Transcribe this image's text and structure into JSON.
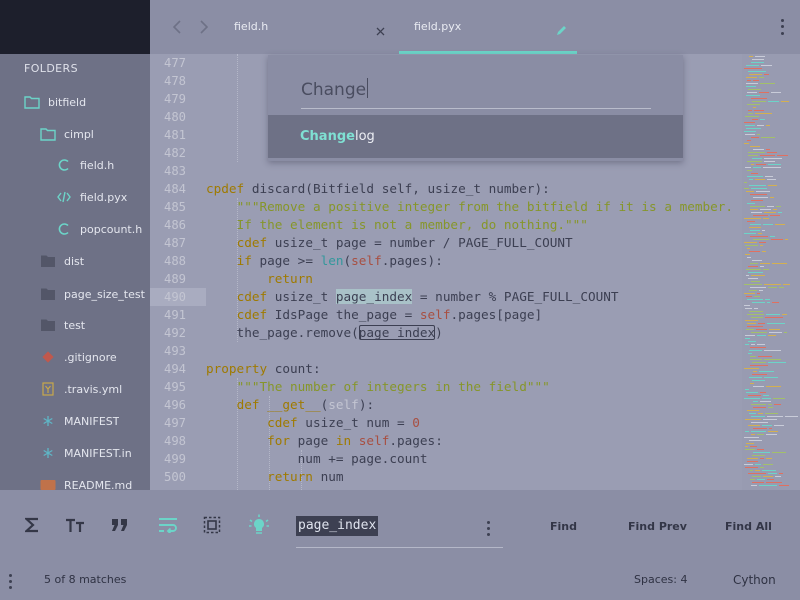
{
  "sidebar": {
    "title": "FOLDERS",
    "items": [
      {
        "label": "bitfield",
        "icon": "folder-open-icon"
      },
      {
        "label": "cimpl",
        "icon": "folder-open-icon"
      },
      {
        "label": "field.h",
        "icon": "c-file-icon"
      },
      {
        "label": "field.pyx",
        "icon": "code-file-icon"
      },
      {
        "label": "popcount.h",
        "icon": "c-file-icon"
      },
      {
        "label": "dist",
        "icon": "folder-icon"
      },
      {
        "label": "page_size_test",
        "icon": "folder-icon"
      },
      {
        "label": "test",
        "icon": "folder-icon"
      },
      {
        "label": ".gitignore",
        "icon": "git-icon"
      },
      {
        "label": ".travis.yml",
        "icon": "yaml-file-icon"
      },
      {
        "label": "MANIFEST",
        "icon": "asterisk-icon"
      },
      {
        "label": "MANIFEST.in",
        "icon": "asterisk-icon"
      },
      {
        "label": "README.md",
        "icon": "markdown-file-icon"
      }
    ]
  },
  "tabs": [
    {
      "label": "field.h",
      "icon": "close-icon"
    },
    {
      "label": "field.pyx",
      "icon": "edit-pencil-icon",
      "active": true
    }
  ],
  "palette": {
    "query": "Change",
    "result_match": "Change",
    "result_rest": "log"
  },
  "editor": {
    "line_numbers": [
      "477",
      "478",
      "479",
      "480",
      "481",
      "482",
      "483",
      "484",
      "485",
      "486",
      "487",
      "488",
      "489",
      "490",
      "491",
      "492",
      "493",
      "494",
      "495",
      "496",
      "497",
      "498",
      "499",
      "500"
    ],
    "active_line": "490",
    "minimap_colors": [
      "#6cd4c8",
      "#d4b050",
      "#c9ccd9",
      "#a3c06a",
      "#e07060"
    ]
  },
  "findbar": {
    "icons": [
      "sigma-icon",
      "text-size-icon",
      "quote-icon",
      "wrap-icon",
      "selection-icon",
      "highlight-bulb-icon"
    ],
    "query": "page_index",
    "find": "Find",
    "find_prev": "Find Prev",
    "find_all": "Find All"
  },
  "statusbar": {
    "matches": "5 of 8 matches",
    "spaces": "Spaces: 4",
    "language": "Cython"
  },
  "colors": {
    "accent": "#6cd4c8",
    "sidebar_bg": "#6e7186",
    "sidebar_header": "#1d1f2c",
    "editor_bg": "#9a9db3"
  }
}
